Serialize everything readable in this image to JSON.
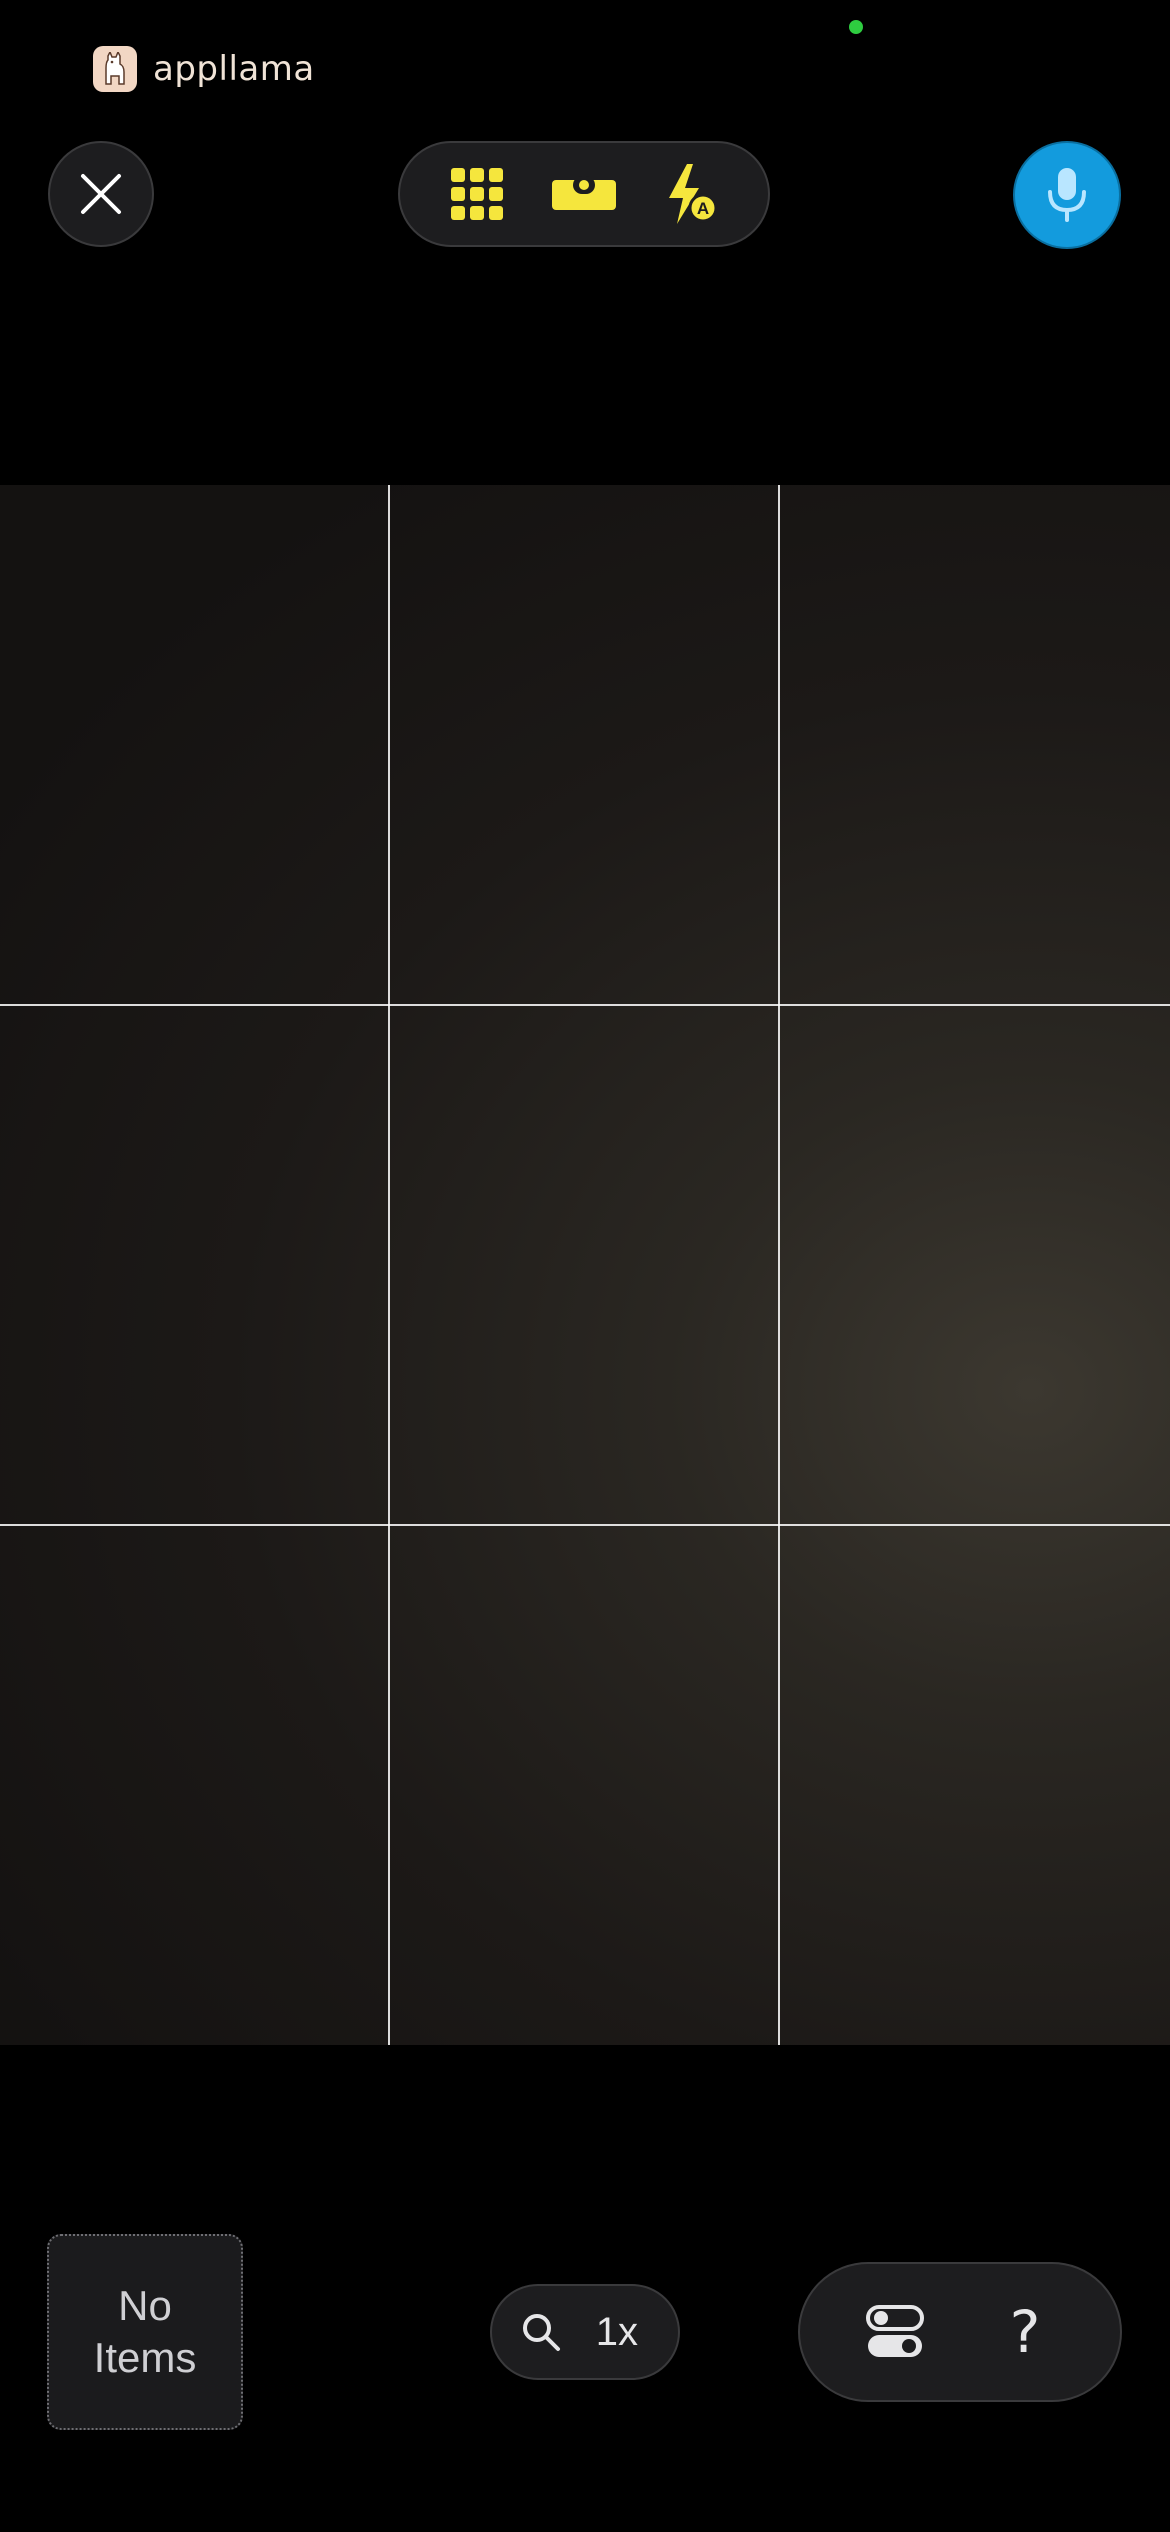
{
  "status_bar": {
    "indicator": "green-dot"
  },
  "brand": {
    "name": "appllama",
    "logo": "llama-logo"
  },
  "top_bar": {
    "close": "close-icon",
    "tools": [
      {
        "name": "grid-icon"
      },
      {
        "name": "level-icon"
      },
      {
        "name": "flash-auto-icon"
      }
    ],
    "mic": "microphone-icon"
  },
  "viewfinder": {
    "grid": "3x3"
  },
  "bottom_bar": {
    "items_label_line1": "No",
    "items_label_line2": "Items",
    "zoom_value": "1x",
    "help_label": "?"
  },
  "colors": {
    "accent_yellow": "#f5e63d",
    "mic_blue": "#139bdd",
    "background": "#000000"
  }
}
